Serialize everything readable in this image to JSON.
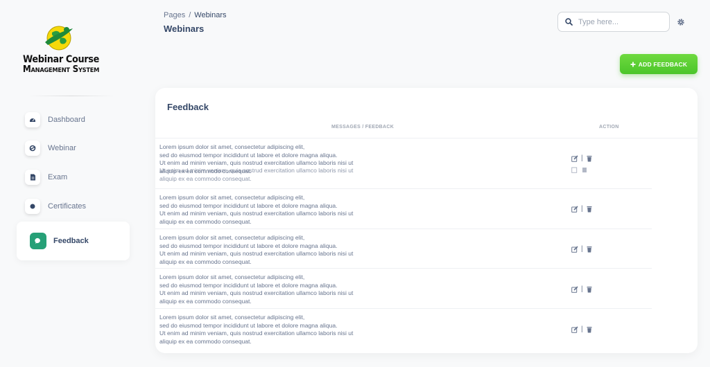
{
  "brand": {
    "line1": "Webinar Course",
    "line2": "Management System",
    "colors": {
      "globe": "#f5d90a",
      "ring": "#1f8a3a"
    }
  },
  "sidebar": {
    "items": [
      {
        "label": "Dashboard",
        "icon": "dashboard-icon"
      },
      {
        "label": "Webinar",
        "icon": "webinar-icon"
      },
      {
        "label": "Exam",
        "icon": "document-icon"
      },
      {
        "label": "Certificates",
        "icon": "certificate-icon"
      },
      {
        "label": "Feedback",
        "icon": "chat-icon",
        "active": true
      }
    ],
    "active_color": "#26a077"
  },
  "header": {
    "breadcrumb": {
      "root": "Pages",
      "separator": "/",
      "current": "Webinars"
    },
    "title": "Webinars",
    "search": {
      "placeholder": "Type here...",
      "value": ""
    },
    "settings_icon": "gear-icon"
  },
  "toolbar": {
    "add_label": "ADD FEEDBACK",
    "add_icon": "plus-icon",
    "add_color": "#52c42e"
  },
  "feedback": {
    "title": "Feedback",
    "columns": {
      "message": "MESSAGES / FEEDBACK",
      "action": "ACTION"
    },
    "rows": [
      {
        "lines": [
          "Lorem ipsum dolor sit amet, consectetur adipiscing elit,",
          "sed do eiusmod tempor incididunt ut labore et dolore magna aliqua.",
          "Ut enim ad minim veniam, quis nostrud exercitation ullamco laboris nisi ut",
          "aliquip ex ea commodo consequat."
        ]
      },
      {
        "lines": [
          "Lorem ipsum dolor sit amet, consectetur adipiscing elit,",
          "sed do eiusmod tempor incididunt ut labore et dolore magna aliqua.",
          "Ut enim ad minim veniam, quis nostrud exercitation ullamco laboris nisi ut",
          "aliquip ex ea commodo consequat."
        ]
      },
      {
        "lines": [
          "Lorem ipsum dolor sit amet, consectetur adipiscing elit,",
          "sed do eiusmod tempor incididunt ut labore et dolore magna aliqua.",
          "Ut enim ad minim veniam, quis nostrud exercitation ullamco laboris nisi ut",
          "aliquip ex ea commodo consequat."
        ]
      },
      {
        "lines": [
          "Lorem ipsum dolor sit amet, consectetur adipiscing elit,",
          "sed do eiusmod tempor incididunt ut labore et dolore magna aliqua.",
          "Ut enim ad minim veniam, quis nostrud exercitation ullamco laboris nisi ut",
          "aliquip ex ea commodo consequat."
        ]
      },
      {
        "lines": [
          "Lorem ipsum dolor sit amet, consectetur adipiscing elit,",
          "sed do eiusmod tempor incididunt ut labore et dolore magna aliqua.",
          "Ut enim ad minim veniam, quis nostrud exercitation ullamco laboris nisi ut",
          "aliquip ex ea commodo consequat."
        ]
      }
    ],
    "ghost_lines": [
      "Ut enim ad minim veniam, quis nostrud exercitation ullamco laboris nisi ut",
      "aliquip ex ea commodo consequat."
    ],
    "action_separator": "|",
    "action_icons": {
      "edit": "edit-icon",
      "delete": "trash-icon"
    }
  }
}
